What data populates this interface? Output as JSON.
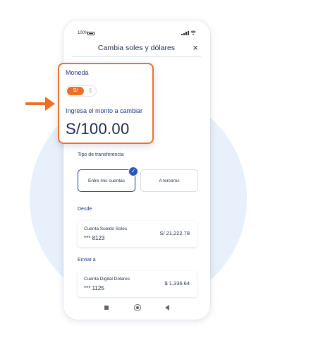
{
  "status_bar": {
    "battery": "100%"
  },
  "header": {
    "title": "Cambia soles y dólares",
    "close": "×"
  },
  "currency_card": {
    "label": "Moneda",
    "toggle_soles": "S/",
    "toggle_dollars": "$",
    "amount_label": "Ingresa el monto a cambiar",
    "amount": "S/100.00"
  },
  "transfer_type": {
    "label": "Tipo de transferencia",
    "option_own": "Entre mis cuentas",
    "option_third": "A terceros",
    "check": "✓"
  },
  "from": {
    "label": "Desde",
    "account_name": "Cuenta Sueldo Soles",
    "account_number": "*** 8123",
    "balance": "S/ 21,222.78"
  },
  "to": {
    "label": "Enviar a",
    "account_name": "Cuenta Digital Dólares",
    "account_number": "*** 1125",
    "balance": "$ 1,336.64"
  },
  "colors": {
    "accent": "#ef6e26",
    "primary": "#1d3e92",
    "circle": "#e7f0fb"
  }
}
